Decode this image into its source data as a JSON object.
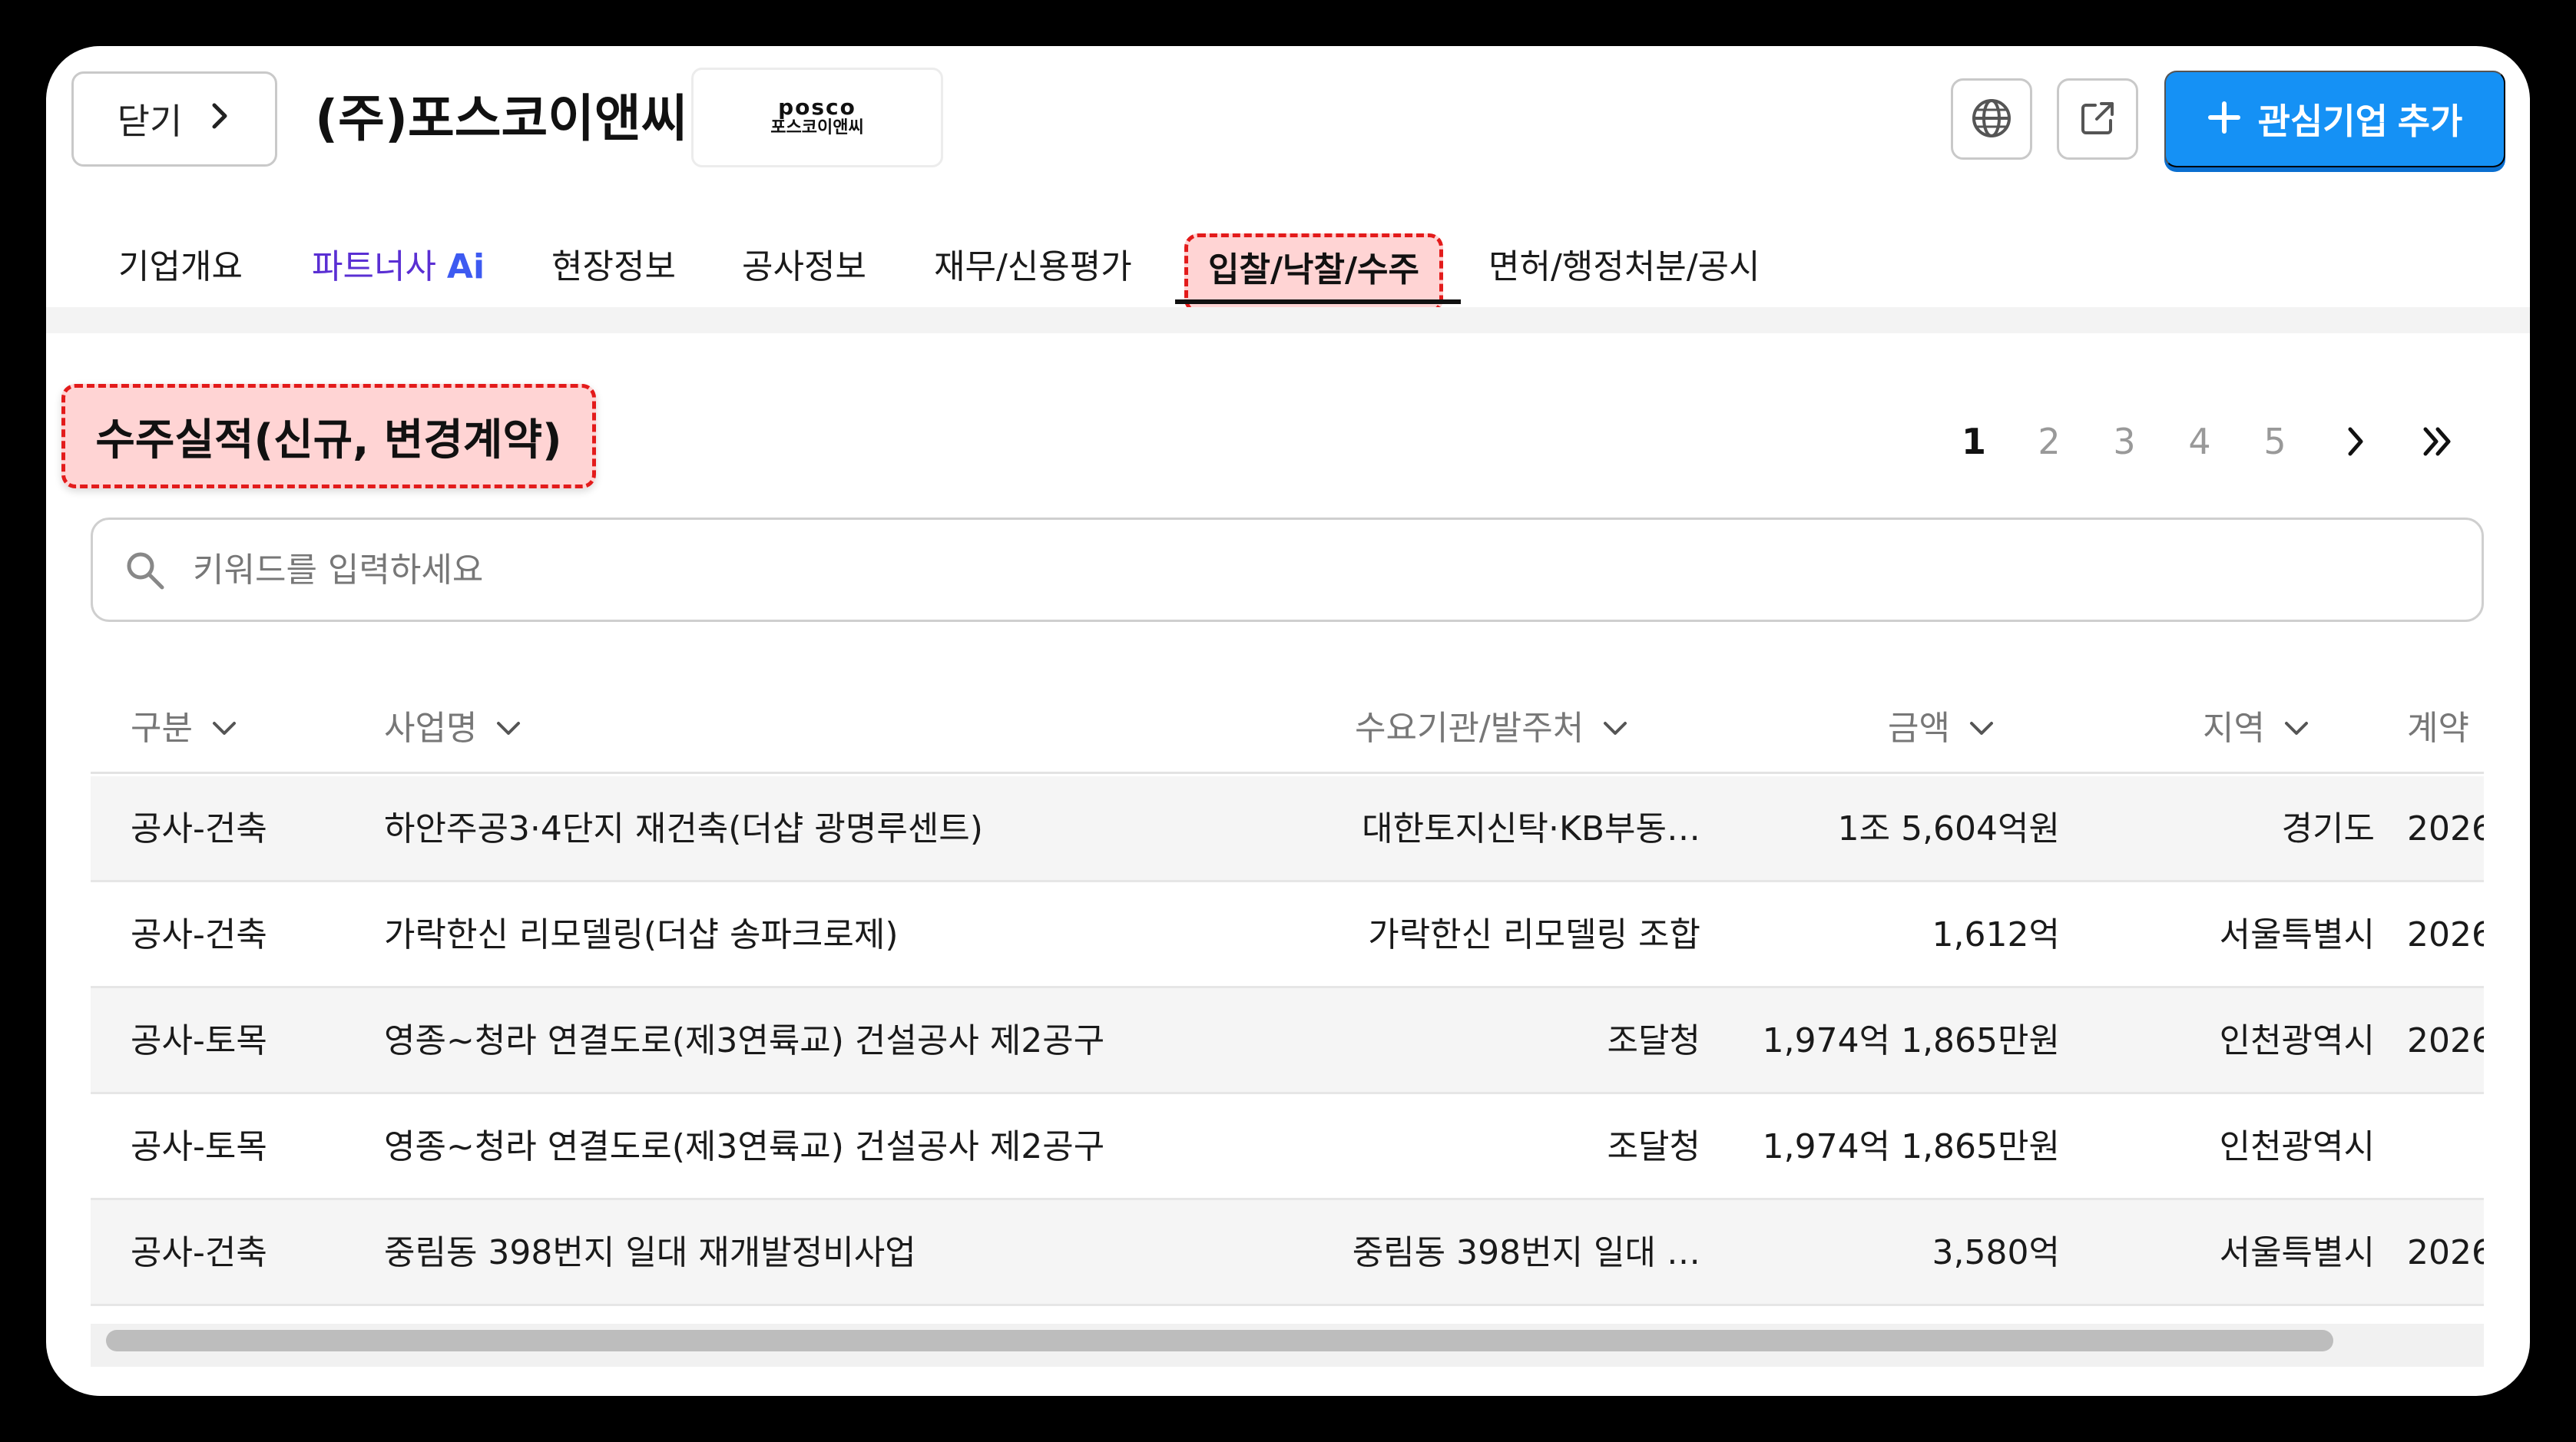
{
  "header": {
    "close_label": "닫기",
    "company_name": "(주)포스코이앤씨",
    "logo_line1": "posco",
    "logo_line2": "포스코이앤씨",
    "add_button_label": "관심기업 추가"
  },
  "tabs": [
    {
      "label": "기업개요"
    },
    {
      "label": "파트너사 ",
      "label_suffix": "Ai"
    },
    {
      "label": "현장정보"
    },
    {
      "label": "공사정보"
    },
    {
      "label": "재무/신용평가"
    },
    {
      "label": "입찰/낙찰/수주",
      "active": true
    },
    {
      "label": "면허/행정처분/공시"
    }
  ],
  "section": {
    "title": "수주실적(신규, 변경계약)"
  },
  "pagination": {
    "pages": [
      "1",
      "2",
      "3",
      "4",
      "5"
    ],
    "current": "1"
  },
  "search": {
    "placeholder": "키워드를 입력하세요"
  },
  "table": {
    "columns": [
      {
        "label": "구분"
      },
      {
        "label": "사업명"
      },
      {
        "label": "수요기관/발주처"
      },
      {
        "label": "금액"
      },
      {
        "label": "지역"
      },
      {
        "label": "계약"
      }
    ],
    "rows": [
      {
        "type": "공사-건축",
        "name": "하안주공3·4단지 재건축(더샵 광명루센트)",
        "client": "대한토지신탁·KB부동…",
        "amount": "1조 5,604억원",
        "region": "경기도",
        "date": "2026"
      },
      {
        "type": "공사-건축",
        "name": "가락한신 리모델링(더샵 송파크로제)",
        "client": "가락한신 리모델링 조합",
        "amount": "1,612억",
        "region": "서울특별시",
        "date": "2026"
      },
      {
        "type": "공사-토목",
        "name": "영종~청라 연결도로(제3연륙교) 건설공사 제2공구",
        "client": "조달청",
        "amount": "1,974억 1,865만원",
        "region": "인천광역시",
        "date": "2026"
      },
      {
        "type": "공사-토목",
        "name": "영종~청라 연결도로(제3연륙교) 건설공사 제2공구",
        "client": "조달청",
        "amount": "1,974억 1,865만원",
        "region": "인천광역시",
        "date": ""
      },
      {
        "type": "공사-건축",
        "name": "중림동 398번지 일대 재개발정비사업",
        "client": "중림동 398번지 일대 …",
        "amount": "3,580억",
        "region": "서울특별시",
        "date": "2026"
      }
    ]
  },
  "colors": {
    "accent": "#1591f5",
    "highlight_fill": "#ffd4d4",
    "highlight_border": "#e31b1b",
    "ai_tab": "#5a2fd3"
  }
}
